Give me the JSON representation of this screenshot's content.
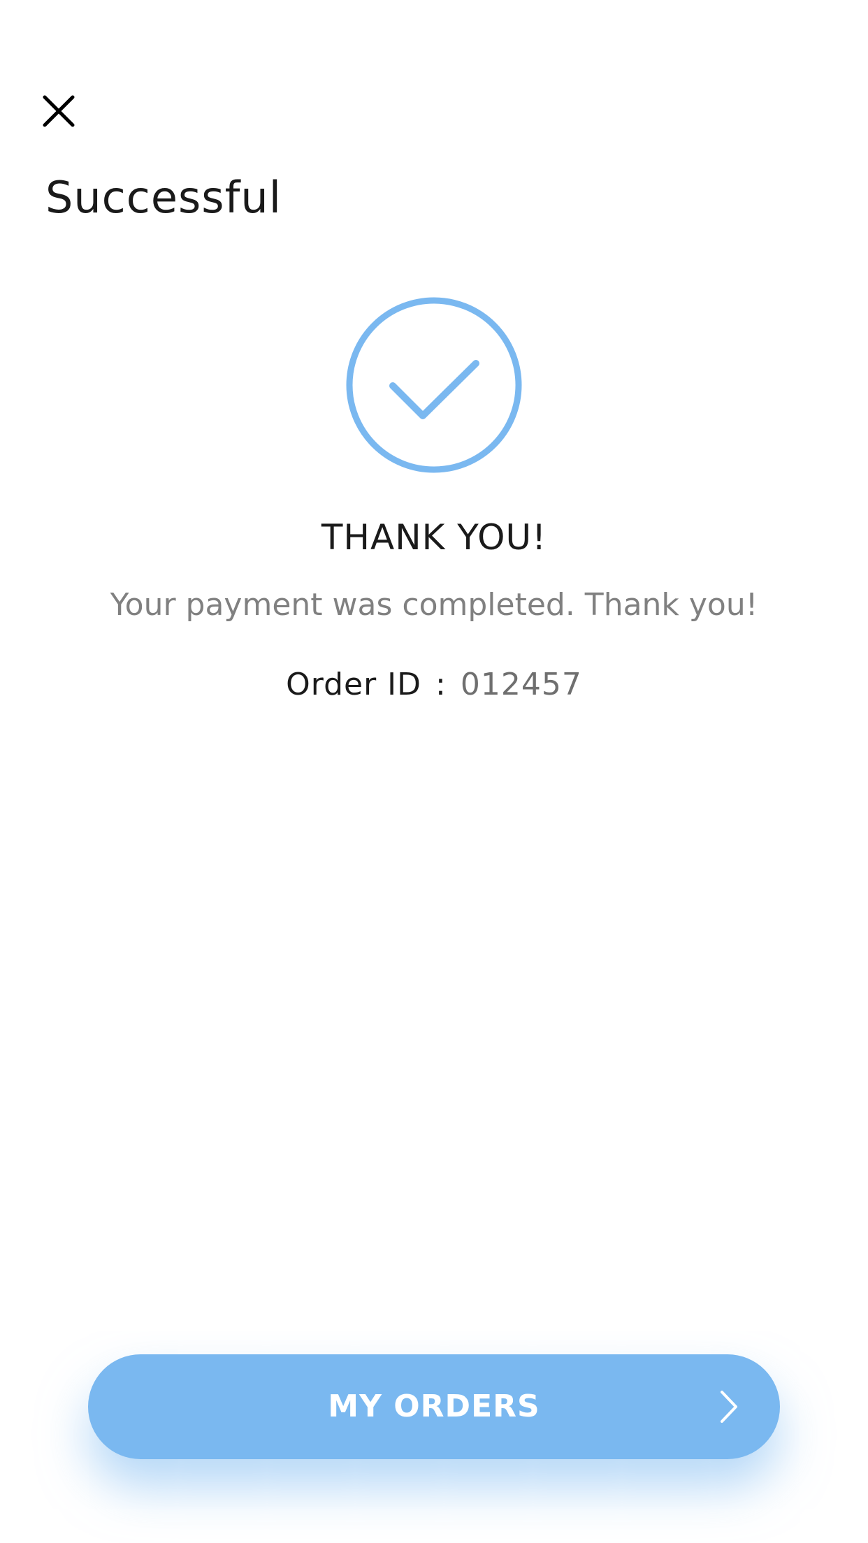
{
  "header": {
    "close_icon": "close-icon",
    "title": "Successful"
  },
  "confirmation": {
    "icon": "check-circle-icon",
    "heading": "THANK YOU!",
    "message": "Your payment was completed. Thank you!",
    "order_label": "Order ID",
    "order_separator": ":",
    "order_id": "012457"
  },
  "footer": {
    "button_label": "MY ORDERS",
    "button_icon": "chevron-right-icon"
  },
  "colors": {
    "accent": "#7ab8f0",
    "text_primary": "#1a1a1a",
    "text_secondary": "#808080",
    "background": "#ffffff"
  }
}
